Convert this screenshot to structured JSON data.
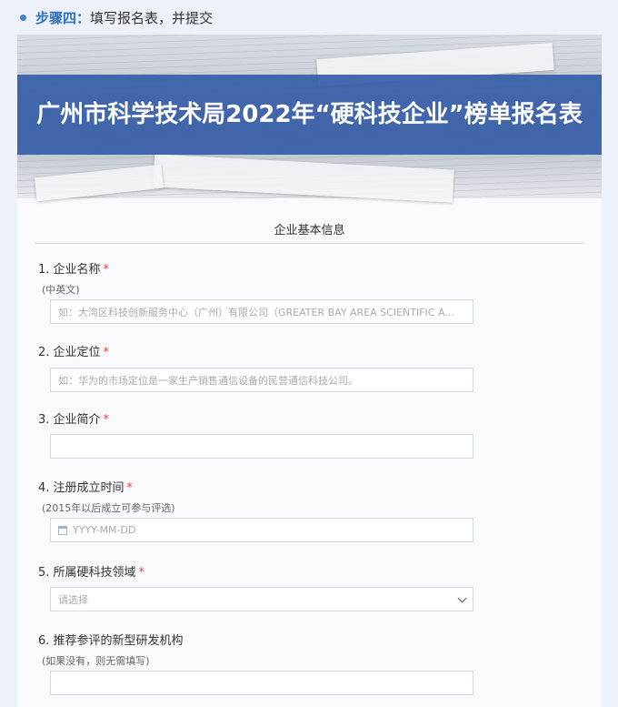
{
  "step": {
    "label": "步骤四：",
    "text": "填写报名表，并提交"
  },
  "banner": {
    "title": "广州市科学技术局2022年“硬科技企业”榜单报名表"
  },
  "section": {
    "title": "企业基本信息"
  },
  "questions": [
    {
      "label": "1. 企业名称",
      "required": "*",
      "hint": "(中英文)",
      "placeholder": "如：大湾区科技创新服务中心（广州）有限公司（GREATER BAY AREA SCIENTIFIC A..."
    },
    {
      "label": "2. 企业定位",
      "required": "*",
      "placeholder": "如：华为的市场定位是一家生产销售通信设备的民营通信科技公司。"
    },
    {
      "label": "3.  企业简介",
      "required": "*",
      "placeholder": ""
    },
    {
      "label": "4. 注册成立时间",
      "required": "*",
      "hint": "(2015年以后成立可参与评选)",
      "placeholder": "YYYY-MM-DD"
    },
    {
      "label": "5. 所属硬科技领域",
      "required": "*",
      "placeholder": "请选择"
    },
    {
      "label": "6. 推荐参评的新型研发机构",
      "hint": "(如果没有，则无需填写)",
      "placeholder": ""
    }
  ],
  "colors": {
    "accent": "#2f6fc4",
    "banner_band": "#385fa8",
    "required": "#e64340"
  }
}
